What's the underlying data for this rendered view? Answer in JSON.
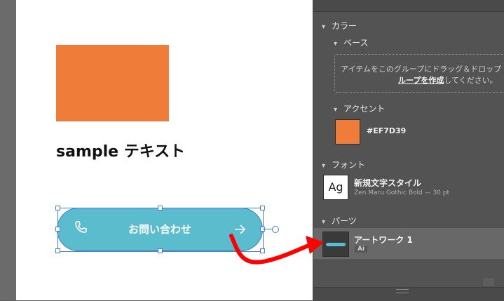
{
  "canvas": {
    "rect_color": "#EF7D39",
    "sample_text": "sample テキスト",
    "button": {
      "label": "お問い合わせ",
      "fill": "#5BBCCD",
      "phone_icon": "phone-icon",
      "arrow_icon": "arrow-right-icon"
    }
  },
  "panel": {
    "color_section": "カラー",
    "base_section": "ベース",
    "drop_zone": {
      "line1": "アイテムをこのグループにドラッグ＆ドロップ",
      "link": "ループを作成",
      "line2_tail": "してください。"
    },
    "accent_section": "アクセント",
    "accent_hex": "#EF7D39",
    "font_section": "フォント",
    "font_thumb": "Ag",
    "font_name": "新規文字スタイル",
    "font_detail": "Zen Maru Gothic Bold — 30 pt",
    "parts_section": "パーツ",
    "part_name": "アートワーク 1",
    "part_badge": "Ai"
  },
  "annotation_color": "#FF0000"
}
